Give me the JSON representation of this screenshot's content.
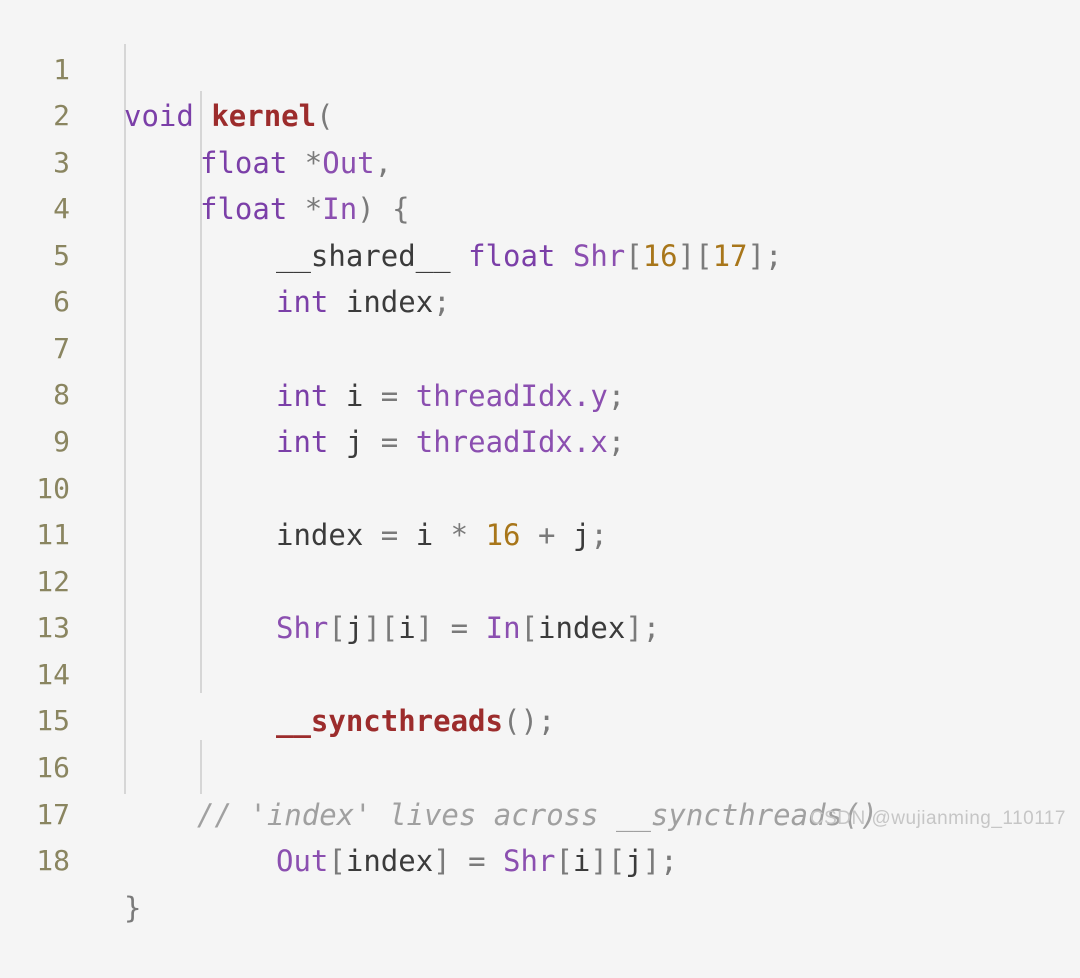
{
  "editor": {
    "background": "#f5f5f5",
    "gutter_color": "#8a8560",
    "indent_guide_color": "#d6d6d6",
    "language": "CUDA C++",
    "line_numbers": [
      "1",
      "2",
      "3",
      "4",
      "5",
      "6",
      "7",
      "8",
      "9",
      "10",
      "11",
      "12",
      "13",
      "14",
      "15",
      "16",
      "17",
      "18"
    ]
  },
  "colors": {
    "keyword": "#7b3fa8",
    "function": "#9c2c2c",
    "identifier": "#8b4fb0",
    "plain": "#3b3b3b",
    "number": "#a8761a",
    "punctuation": "#7a7a7a",
    "comment": "#a0a0a0"
  },
  "code": {
    "lines": [
      {
        "number": "1",
        "indent": 0,
        "text": "void kernel("
      },
      {
        "number": "2",
        "indent": 1,
        "text": "float *Out,"
      },
      {
        "number": "3",
        "indent": 1,
        "text": "float *In) {"
      },
      {
        "number": "4",
        "indent": 2,
        "text": "__shared__ float Shr[16][17];"
      },
      {
        "number": "5",
        "indent": 2,
        "text": "int index;"
      },
      {
        "number": "6",
        "indent": 0,
        "text": ""
      },
      {
        "number": "7",
        "indent": 2,
        "text": "int i = threadIdx.y;"
      },
      {
        "number": "8",
        "indent": 2,
        "text": "int j = threadIdx.x;"
      },
      {
        "number": "9",
        "indent": 0,
        "text": ""
      },
      {
        "number": "10",
        "indent": 2,
        "text": "index = i * 16 + j;"
      },
      {
        "number": "11",
        "indent": 0,
        "text": ""
      },
      {
        "number": "12",
        "indent": 2,
        "text": "Shr[j][i] = In[index];"
      },
      {
        "number": "13",
        "indent": 0,
        "text": ""
      },
      {
        "number": "14",
        "indent": 2,
        "text": "__syncthreads();"
      },
      {
        "number": "15",
        "indent": 0,
        "text": ""
      },
      {
        "number": "16",
        "indent": 1,
        "text": "// 'index' lives across __syncthreads()"
      },
      {
        "number": "17",
        "indent": 2,
        "text": "Out[index] = Shr[i][j];"
      },
      {
        "number": "18",
        "indent": 0,
        "text": "}"
      }
    ]
  },
  "watermark": {
    "text": "CSDN @wujianming_110117"
  }
}
